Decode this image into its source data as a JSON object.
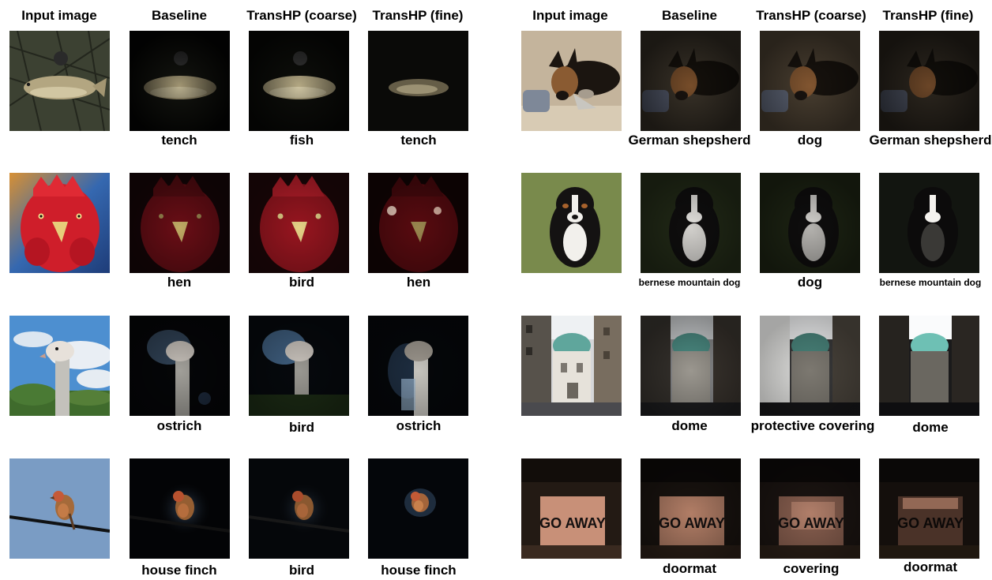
{
  "headers": {
    "left": [
      "Input image",
      "Baseline",
      "TransHP (coarse)",
      "TransHP (fine)"
    ],
    "right": [
      "Input image",
      "Baseline",
      "TransHP (coarse)",
      "TransHP (fine)"
    ]
  },
  "rows": [
    {
      "left": {
        "subject": "tench fish in net",
        "predictions": [
          "tench",
          "fish",
          "tench"
        ]
      },
      "right": {
        "subject": "german shepherd puppy",
        "predictions": [
          "German shepsherd",
          "dog",
          "German shepsherd"
        ]
      }
    },
    {
      "left": {
        "subject": "rooster head",
        "predictions": [
          "hen",
          "bird",
          "hen"
        ]
      },
      "right": {
        "subject": "bernese mountain dog puppy",
        "predictions": [
          "bernese mountain dog",
          "dog",
          "bernese mountain dog"
        ]
      }
    },
    {
      "left": {
        "subject": "ostrich head against sky",
        "predictions": [
          "ostrich",
          "bird",
          "ostrich"
        ]
      },
      "right": {
        "subject": "street with domed building",
        "predictions": [
          "dome",
          "protective covering",
          "dome"
        ]
      }
    },
    {
      "left": {
        "subject": "finch on wire",
        "predictions": [
          "house finch",
          "bird",
          "house finch"
        ]
      },
      "right": {
        "subject": "doormat",
        "predictions": [
          "doormat",
          "covering",
          "doormat"
        ]
      }
    }
  ],
  "doormat_text": "GO AWAY"
}
